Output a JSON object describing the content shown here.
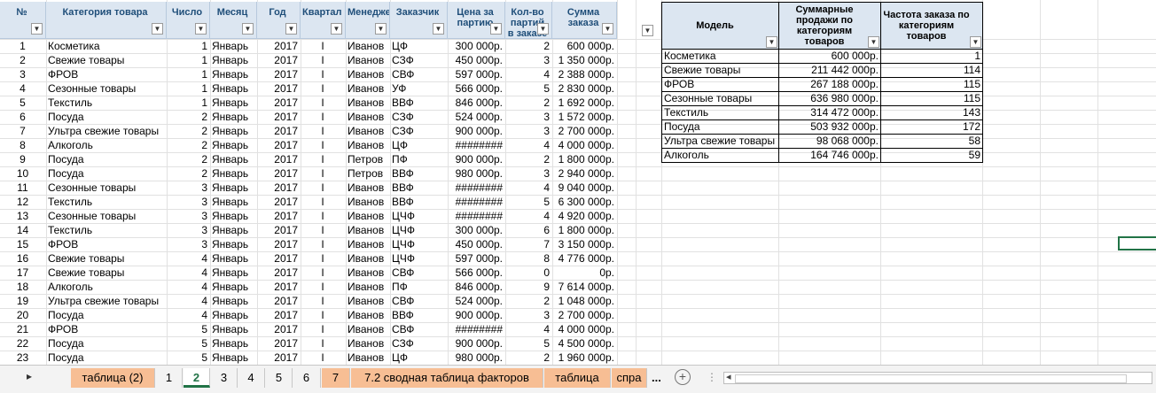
{
  "table1": {
    "headers": [
      "№",
      "Категория товара",
      "Число",
      "Месяц",
      "Год",
      "Квартал",
      "Менеджер",
      "Заказчик",
      "Цена за партию",
      "Кол-во партий в заказе",
      "Сумма заказа"
    ],
    "rows": [
      [
        "1",
        "Косметика",
        "1",
        "Январь",
        "2017",
        "I",
        "Иванов",
        "ЦФ",
        "300 000р.",
        "2",
        "600 000р."
      ],
      [
        "2",
        "Свежие товары",
        "1",
        "Январь",
        "2017",
        "I",
        "Иванов",
        "СЗФ",
        "450 000р.",
        "3",
        "1 350 000р."
      ],
      [
        "3",
        "ФРОВ",
        "1",
        "Январь",
        "2017",
        "I",
        "Иванов",
        "СВФ",
        "597 000р.",
        "4",
        "2 388 000р."
      ],
      [
        "4",
        "Сезонные товары",
        "1",
        "Январь",
        "2017",
        "I",
        "Иванов",
        "УФ",
        "566 000р.",
        "5",
        "2 830 000р."
      ],
      [
        "5",
        "Текстиль",
        "1",
        "Январь",
        "2017",
        "I",
        "Иванов",
        "ВВФ",
        "846 000р.",
        "2",
        "1 692 000р."
      ],
      [
        "6",
        "Посуда",
        "2",
        "Январь",
        "2017",
        "I",
        "Иванов",
        "СЗФ",
        "524 000р.",
        "3",
        "1 572 000р."
      ],
      [
        "7",
        "Ультра свежие товары",
        "2",
        "Январь",
        "2017",
        "I",
        "Иванов",
        "СЗФ",
        "900 000р.",
        "3",
        "2 700 000р."
      ],
      [
        "8",
        "Алкоголь",
        "2",
        "Январь",
        "2017",
        "I",
        "Иванов",
        "ЦФ",
        "########",
        "4",
        "4 000 000р."
      ],
      [
        "9",
        "Посуда",
        "2",
        "Январь",
        "2017",
        "I",
        "Петров",
        "ПФ",
        "900 000р.",
        "2",
        "1 800 000р."
      ],
      [
        "10",
        "Посуда",
        "2",
        "Январь",
        "2017",
        "I",
        "Петров",
        "ВВФ",
        "980 000р.",
        "3",
        "2 940 000р."
      ],
      [
        "11",
        "Сезонные товары",
        "3",
        "Январь",
        "2017",
        "I",
        "Иванов",
        "ВВФ",
        "########",
        "4",
        "9 040 000р."
      ],
      [
        "12",
        "Текстиль",
        "3",
        "Январь",
        "2017",
        "I",
        "Иванов",
        "ВВФ",
        "########",
        "5",
        "6 300 000р."
      ],
      [
        "13",
        "Сезонные товары",
        "3",
        "Январь",
        "2017",
        "I",
        "Иванов",
        "ЦЧФ",
        "########",
        "4",
        "4 920 000р."
      ],
      [
        "14",
        "Текстиль",
        "3",
        "Январь",
        "2017",
        "I",
        "Иванов",
        "ЦЧФ",
        "300 000р.",
        "6",
        "1 800 000р."
      ],
      [
        "15",
        "ФРОВ",
        "3",
        "Январь",
        "2017",
        "I",
        "Иванов",
        "ЦЧФ",
        "450 000р.",
        "7",
        "3 150 000р."
      ],
      [
        "16",
        "Свежие товары",
        "4",
        "Январь",
        "2017",
        "I",
        "Иванов",
        "ЦЧФ",
        "597 000р.",
        "8",
        "4 776 000р."
      ],
      [
        "17",
        "Свежие товары",
        "4",
        "Январь",
        "2017",
        "I",
        "Иванов",
        "СВФ",
        "566 000р.",
        "0",
        "0р."
      ],
      [
        "18",
        "Алкоголь",
        "4",
        "Январь",
        "2017",
        "I",
        "Иванов",
        "ПФ",
        "846 000р.",
        "9",
        "7 614 000р."
      ],
      [
        "19",
        "Ультра свежие товары",
        "4",
        "Январь",
        "2017",
        "I",
        "Иванов",
        "СВФ",
        "524 000р.",
        "2",
        "1 048 000р."
      ],
      [
        "20",
        "Посуда",
        "4",
        "Январь",
        "2017",
        "I",
        "Иванов",
        "ВВФ",
        "900 000р.",
        "3",
        "2 700 000р."
      ],
      [
        "21",
        "ФРОВ",
        "5",
        "Январь",
        "2017",
        "I",
        "Иванов",
        "СВФ",
        "########",
        "4",
        "4 000 000р."
      ],
      [
        "22",
        "Посуда",
        "5",
        "Январь",
        "2017",
        "I",
        "Иванов",
        "СЗФ",
        "900 000р.",
        "5",
        "4 500 000р."
      ],
      [
        "23",
        "Посуда",
        "5",
        "Январь",
        "2017",
        "I",
        "Иванов",
        "ЦФ",
        "980 000р.",
        "2",
        "1 960 000р."
      ]
    ]
  },
  "table2": {
    "headers": [
      "Модель",
      "Суммарные продажи по категориям товаров",
      "Частота заказа по категориям товаров"
    ],
    "rows": [
      [
        "Косметика",
        "600 000р.",
        "1"
      ],
      [
        "Свежие товары",
        "211 442 000р.",
        "114"
      ],
      [
        "ФРОВ",
        "267 188 000р.",
        "115"
      ],
      [
        "Сезонные товары",
        "636 980 000р.",
        "115"
      ],
      [
        "Текстиль",
        "314 472 000р.",
        "143"
      ],
      [
        "Посуда",
        "503 932 000р.",
        "172"
      ],
      [
        "Ультра свежие товары",
        "98 068 000р.",
        "58"
      ],
      [
        "Алкоголь",
        "164 746 000р.",
        "59"
      ]
    ]
  },
  "sheet_tabs": [
    "таблица (2)",
    "1",
    "2",
    "3",
    "4",
    "5",
    "6",
    "7",
    "7.2 сводная таблица факторов",
    "таблица",
    "спра"
  ],
  "active_tab": "2",
  "tab_more": "...",
  "add_sheet": "+",
  "nav_arrow": "▸",
  "scroll_left": "◂",
  "colors": {
    "header_fill": "#dce6f1",
    "tab_orange": "#f7be94",
    "accent": "#217346"
  }
}
